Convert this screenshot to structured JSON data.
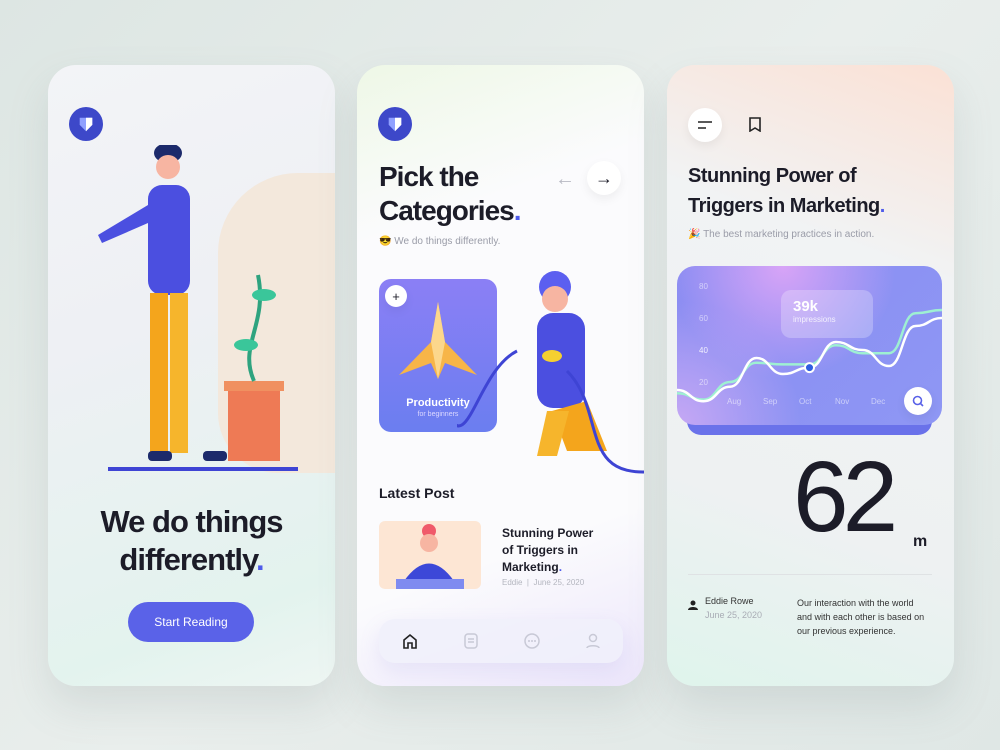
{
  "screen1": {
    "headline": "We do things",
    "headline2": "differently",
    "button": "Start Reading"
  },
  "screen2": {
    "title1": "Pick the",
    "title2": "Categories",
    "subtitle": "We do things differently.",
    "emoji": "😎",
    "category": {
      "name": "Productivity",
      "sub": "for beginners",
      "add": "+"
    },
    "latest_heading": "Latest Post",
    "post": {
      "title1": "Stunning Power",
      "title2": "of Triggers in",
      "title3": "Marketing",
      "author": "Eddie",
      "sep": "|",
      "date": "June 25, 2020"
    },
    "nav": [
      "home",
      "posts",
      "messages",
      "profile"
    ]
  },
  "screen3": {
    "title1": "Stunning Power of",
    "title2": "Triggers in Marketing",
    "emoji": "🎉",
    "subtitle": "The best marketing practices in action.",
    "big_number": "62",
    "unit": "m",
    "author": "Eddie Rowe",
    "date": "June 25, 2020",
    "quote1": "Our interaction with the world",
    "quote2": "and with each other is based on",
    "quote3": "our previous experience."
  },
  "chart_data": {
    "type": "line",
    "categories": [
      "Aug",
      "Sep",
      "Oct",
      "Nov",
      "Dec"
    ],
    "yticks": [
      80,
      60,
      40,
      20
    ],
    "ylim": [
      10,
      90
    ],
    "x": [
      0,
      1,
      2,
      3,
      4,
      5,
      6,
      7,
      8,
      9,
      10
    ],
    "series": [
      {
        "name": "white",
        "color": "#ffffff",
        "values": [
          20,
          13,
          22,
          40,
          30,
          34,
          50,
          45,
          35,
          60,
          65
        ]
      },
      {
        "name": "mint",
        "color": "#9ef0d2",
        "values": [
          18,
          14,
          25,
          37,
          36,
          36,
          48,
          43,
          43,
          68,
          70
        ]
      }
    ],
    "tooltip": {
      "value": "39k",
      "label": "impressions"
    }
  }
}
